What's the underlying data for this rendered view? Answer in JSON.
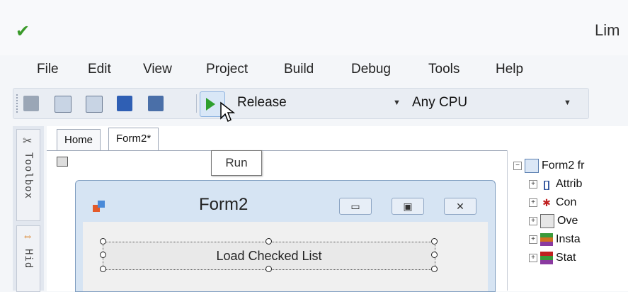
{
  "window": {
    "title": "Lim"
  },
  "menu": {
    "items": [
      "File",
      "Edit",
      "View",
      "Project",
      "Build",
      "Debug",
      "Tools",
      "Help"
    ]
  },
  "toolbar": {
    "configuration": "Release",
    "platform": "Any CPU",
    "run_tooltip": "Run"
  },
  "side": {
    "toolbox": "Toolbox",
    "hidden": "Hid"
  },
  "tabs": [
    {
      "label": "Home"
    },
    {
      "label": "Form2*"
    }
  ],
  "form": {
    "title": "Form2",
    "button_label": "Load Checked List"
  },
  "tree": {
    "items": [
      {
        "label": "Form2 fr"
      },
      {
        "label": "Attrib"
      },
      {
        "label": "Con"
      },
      {
        "label": "Ove"
      },
      {
        "label": "Insta"
      },
      {
        "label": "Stat"
      }
    ]
  },
  "colors": {
    "run_green": "#2ea02e",
    "form_frame": "#d6e4f3",
    "accent_blue": "#4a8ad8"
  }
}
